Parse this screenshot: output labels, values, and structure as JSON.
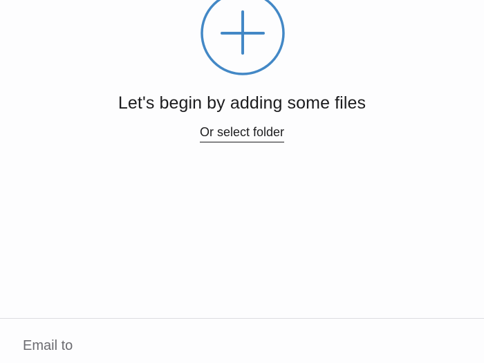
{
  "upload": {
    "add_icon": "plus-circle-icon",
    "accent_color": "#4388c6",
    "headline": "Let's begin by adding some files",
    "select_folder_label": "Or select folder"
  },
  "email": {
    "placeholder": "Email to",
    "value": ""
  }
}
